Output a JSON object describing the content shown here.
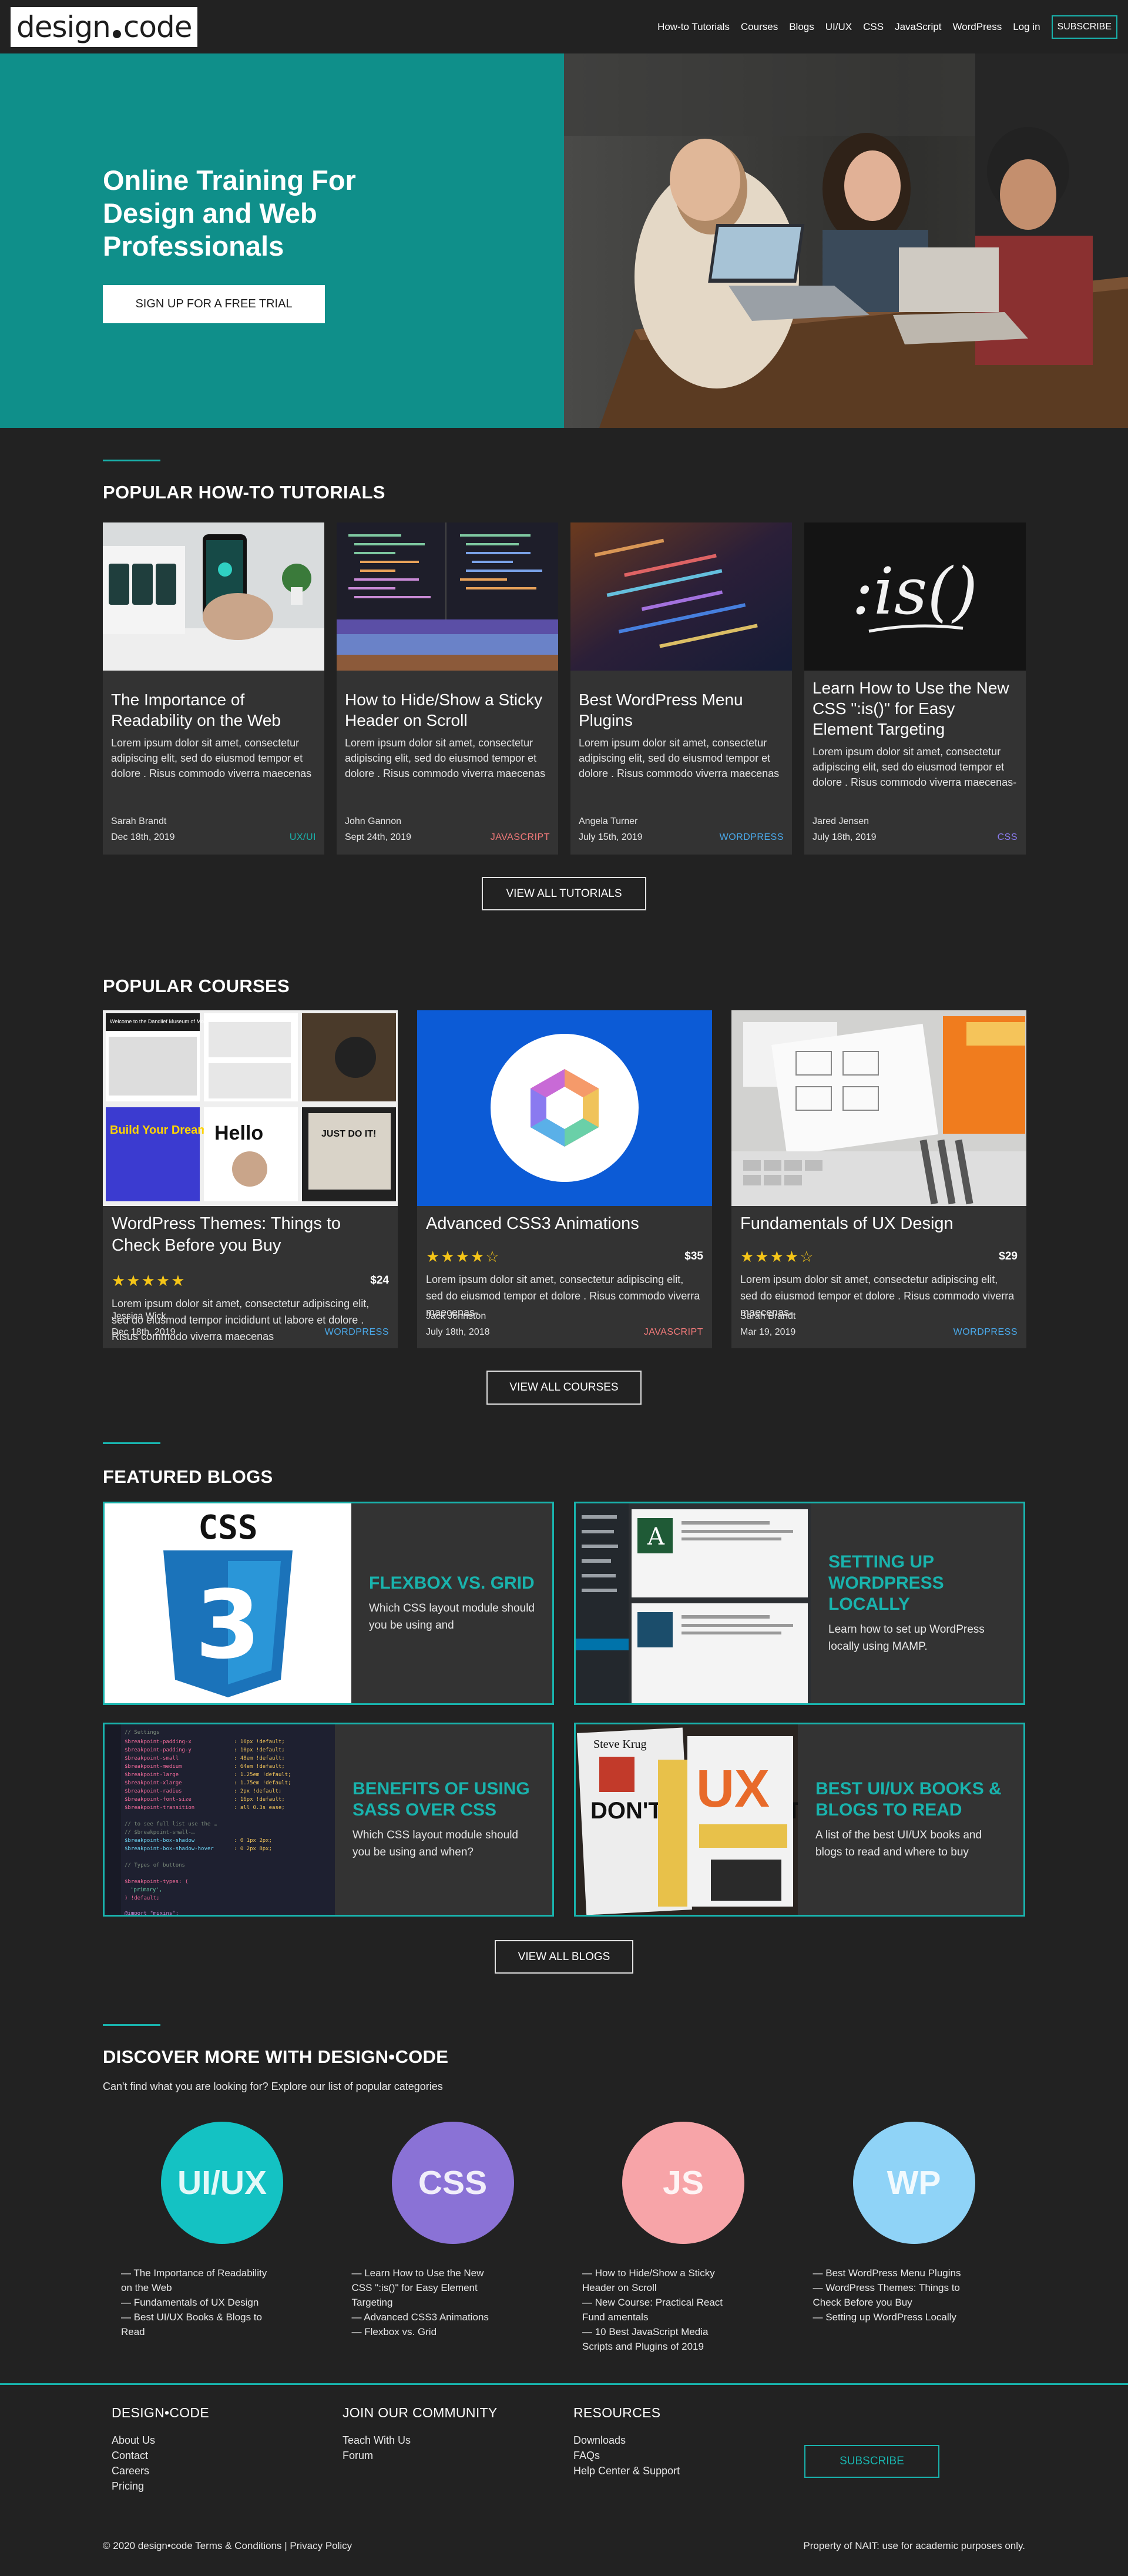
{
  "nav": {
    "logo_left": "design",
    "logo_right": "code",
    "links": [
      "How-to Tutorials",
      "Courses",
      "Blogs",
      "UI/UX",
      "CSS",
      "JavaScript",
      "WordPress",
      "Log in"
    ],
    "subscribe": "SUBSCRIBE"
  },
  "hero": {
    "title": "Online Training For Design and Web Professionals",
    "cta": "SIGN UP FOR A FREE TRIAL",
    "bg_color": "#0f8f8a"
  },
  "tutorials": {
    "title": "POPULAR HOW-TO TUTORIALS",
    "view_all": "VIEW ALL TUTORIALS",
    "cards": [
      {
        "title": "The Importance of Readability on the Web",
        "desc": "Lorem ipsum dolor sit amet, consectetur adipiscing elit, sed do eiusmod tempor et dolore . Risus commodo viverra maecenas",
        "author": "Sarah Brandt",
        "date": "Dec 18th, 2019",
        "tag": "UX/UI",
        "tag_color": "#19b3ad"
      },
      {
        "title": "How to Hide/Show a Sticky Header on Scroll",
        "desc": "Lorem ipsum dolor sit amet, consectetur adipiscing elit, sed do eiusmod tempor et dolore . Risus commodo viverra maecenas",
        "author": "John Gannon",
        "date": "Sept 24th, 2019",
        "tag": "JAVASCRIPT",
        "tag_color": "#f27a7a"
      },
      {
        "title": "Best WordPress Menu Plugins",
        "desc": "Lorem ipsum dolor sit amet, consectetur adipiscing elit, sed do eiusmod tempor et dolore . Risus commodo viverra maecenas",
        "author": "Angela Turner",
        "date": "July 15th, 2019",
        "tag": "WORDPRESS",
        "tag_color": "#4aa8e8"
      },
      {
        "title": "Learn How to Use the New CSS \":is()\" for Easy Element Targeting",
        "desc": "Lorem ipsum dolor sit amet, consectetur adipiscing elit, sed do eiusmod tempor et dolore . Risus commodo viverra maecenas-",
        "author": "Jared Jensen",
        "date": "July 18th, 2019",
        "tag": "CSS",
        "tag_color": "#8b7cf0"
      }
    ]
  },
  "courses": {
    "title": "POPULAR COURSES",
    "view_all": "VIEW ALL COURSES",
    "cards": [
      {
        "title": "WordPress Themes: Things to Check Before you Buy",
        "rating": 5,
        "stars": "★★★★★",
        "price": "$24",
        "desc": "Lorem ipsum dolor sit amet, consectetur adipiscing elit, sed do eiusmod tempor incididunt ut labore et dolore . Risus commodo viverra maecenas",
        "author": "Jessica Wick",
        "date": "Dec 18th, 2019",
        "tag": "WORDPRESS",
        "tag_color": "#4aa8e8"
      },
      {
        "title": "Advanced CSS3 Animations",
        "rating": 4,
        "stars": "★★★★☆",
        "price": "$35",
        "desc": "Lorem ipsum dolor sit amet, consectetur adipiscing elit, sed do eiusmod tempor et dolore . Risus commodo viverra maecenas-",
        "author": "Jack Johnston",
        "date": "July 18th, 2018",
        "tag": "JAVASCRIPT",
        "tag_color": "#f27a7a"
      },
      {
        "title": "Fundamentals of UX Design",
        "rating": 4,
        "stars": "★★★★☆",
        "price": "$29",
        "desc": "Lorem ipsum dolor sit amet, consectetur adipiscing elit, sed do eiusmod tempor et dolore . Risus commodo viverra maecenas-",
        "author": "Sarah Brandt",
        "date": "Mar 19, 2019",
        "tag": "WORDPRESS",
        "tag_color": "#4aa8e8"
      }
    ],
    "thumb_labels": {
      "moma": "Welcome to the Dandilef Museum of Modern Art",
      "hello": "Hello",
      "justdoit": "JUST DO IT!",
      "build": "Build Your Dream!"
    }
  },
  "blogs": {
    "title": "FEATURED BLOGS",
    "view_all": "VIEW ALL BLOGS",
    "cards": [
      {
        "title": "FLEXBOX VS. GRID",
        "desc": "Which CSS layout module should you be using and"
      },
      {
        "title": "SETTING UP WORDPRESS LOCALLY",
        "desc": "Learn how to set up WordPress locally using MAMP."
      },
      {
        "title": "BENEFITS OF USING SASS OVER CSS",
        "desc": "Which CSS layout module should you be using and when?"
      },
      {
        "title": "BEST UI/UX BOOKS & BLOGS TO READ",
        "desc": "A list of the best UI/UX books and blogs to read and where to buy"
      }
    ],
    "css_logo_text": "CSS",
    "css_logo_number": "3",
    "book_author": "Steve Krug",
    "book_title": "DON'T MAKE ME THINK",
    "ux_book": "UX"
  },
  "discover": {
    "title": "DISCOVER MORE WITH DESIGN•CODE",
    "subtitle": "Can't find what you are looking for? Explore our list of popular categories",
    "categories": [
      {
        "label": "UI/UX",
        "color": "#14c2c3",
        "links": [
          "— The Importance of Readability on the Web",
          "— Fundamentals of UX Design",
          "— Best UI/UX Books & Blogs to Read"
        ]
      },
      {
        "label": "CSS",
        "color": "#8a72d6",
        "links": [
          "— Learn How to Use the New CSS \":is()\" for Easy Element Targeting",
          "— Advanced CSS3 Animations",
          "— Flexbox vs. Grid"
        ]
      },
      {
        "label": "JS",
        "color": "#f7a4a8",
        "links": [
          "— How to Hide/Show a Sticky Header on Scroll",
          "— New Course: Practical React Fund amentals",
          "— 10 Best JavaScript Media Scripts and Plugins of 2019"
        ]
      },
      {
        "label": "WP",
        "color": "#8fd3f7",
        "links": [
          "— Best WordPress Menu Plugins",
          "— WordPress Themes: Things to Check Before you Buy",
          "— Setting up WordPress Locally"
        ]
      }
    ]
  },
  "footer": {
    "cols": [
      {
        "head": "DESIGN•CODE",
        "links": [
          "About Us",
          "Contact",
          "Careers",
          "Pricing"
        ]
      },
      {
        "head": "JOIN OUR COMMUNITY",
        "links": [
          "Teach With Us",
          "Forum"
        ]
      },
      {
        "head": "RESOURCES",
        "links": [
          "Downloads",
          "FAQs",
          "Help Center & Support"
        ]
      }
    ],
    "subscribe": "SUBSCRIBE",
    "copyright": "© 2020 design•code Terms & Conditions | Privacy Policy",
    "note": "Property of NAIT: use for academic purposes only."
  }
}
